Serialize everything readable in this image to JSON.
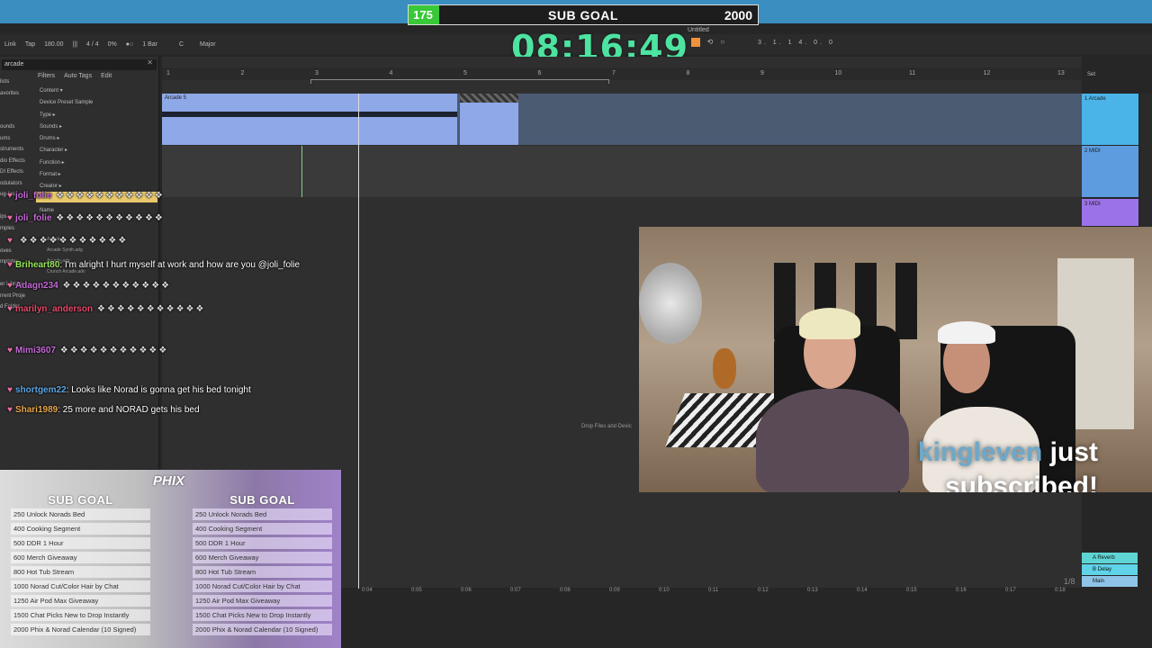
{
  "sub_goal": {
    "current": "175",
    "title": "SUB GOAL",
    "target": "2000",
    "progress_fraction": 0.0875
  },
  "timer": "08:16:49",
  "daw": {
    "transport": {
      "link": "Link",
      "tap": "Tap",
      "tempo": "180.00",
      "signature": "4 / 4",
      "percent": "0%",
      "quantize": "1 Bar",
      "key": "C",
      "scale": "Major",
      "title": "Untitled",
      "right_nums": "3.  1.  1        4.  0.  0"
    },
    "browser": {
      "search_value": "arcade",
      "filters": "Filters",
      "auto_tags": "Auto Tags",
      "edit": "Edit",
      "filter_items": [
        "Content ▾",
        "Device  Preset  Sample",
        "Type ▸",
        "Sounds ▸",
        "Drums ▸",
        "Character ▸",
        "Function ▸",
        "Format ▸",
        "Creator ▸",
        "",
        "Name"
      ],
      "sidebar_items": [
        "lists",
        "avorites",
        "",
        "",
        "ounds",
        "ums",
        "struments",
        "dio Effects",
        "DI Effects",
        "odulators",
        "ug-Ins",
        "",
        "ips",
        "mples",
        "",
        "oves",
        "mplates",
        "",
        "er Library",
        "rrent Proje",
        "d Folder"
      ],
      "files": [
        "Arcade",
        "Arcade Synth.adg",
        "Arcade.adg",
        "Crunch Arcade.adv"
      ]
    },
    "arrangement": {
      "ruler_marks": [
        "1",
        "2",
        "3",
        "4",
        "5",
        "6",
        "7",
        "8",
        "9",
        "10",
        "11",
        "12",
        "13"
      ],
      "clip_label": "Arcade 5",
      "drop_hint": "Drop Files and Devic",
      "bottom_times": [
        "0:04",
        "0:05",
        "0:06",
        "0:07",
        "0:08",
        "0:09",
        "0:10",
        "0:11",
        "0:12",
        "0:13",
        "0:14",
        "0:15",
        "0:16",
        "0:17",
        "0:18"
      ],
      "set_label": "Set"
    },
    "tracks": [
      {
        "name": "1 Arcade",
        "color": "#4ab4e8"
      },
      {
        "name": "2 MIDI",
        "color": "#5e9ce0"
      },
      {
        "name": "3 MIDI",
        "color": "#9c72e8"
      }
    ],
    "returns": [
      {
        "name": "A Reverb",
        "color": "#5fd4d4"
      },
      {
        "name": "B Delay",
        "color": "#5fd4e8"
      },
      {
        "name": "Main",
        "color": "#8ec4e8"
      }
    ],
    "page_counter": "1/8"
  },
  "chat": [
    {
      "user": "joli_folie",
      "text": "",
      "color": "#c46ad6"
    },
    {
      "user": "joli_folie",
      "text": "",
      "color": "#c46ad6"
    },
    {
      "user": "",
      "text": "",
      "color": "#e8496a"
    },
    {
      "user": "Briheart80",
      "text": "I'm alright I hurt myself at work and how are you @joli_folie",
      "color": "#9be85c"
    },
    {
      "user": "Adagn234",
      "text": "",
      "color": "#c46ad6"
    },
    {
      "user": "marilyn_anderson",
      "text": "",
      "color": "#e8496a"
    },
    {
      "user": "Mimi3607",
      "text": "",
      "color": "#c46ad6"
    },
    {
      "user": "shortgem22",
      "text": "Looks like Norad is gonna get his bed tonight",
      "color": "#5ca8e8"
    },
    {
      "user": "Shari1989",
      "text": "25 more and NORAD gets his bed",
      "color": "#e8a84c"
    }
  ],
  "sub_alert": {
    "user": "kingleven",
    "text_1": "just",
    "text_2": "subscribed!"
  },
  "goal_panel": {
    "logo": "PHIX",
    "col_title": "SUB GOAL",
    "items": [
      "250 Unlock Norads Bed",
      "400 Cooking Segment",
      "500 DDR 1 Hour",
      "600 Merch Giveaway",
      "800 Hot Tub Stream",
      "1000 Norad Cut/Color Hair by Chat",
      "1250 Air Pod Max Giveaway",
      "1500 Chat Picks New to Drop Instantly",
      "2000 Phix & Norad Calendar (10 Signed)"
    ]
  }
}
